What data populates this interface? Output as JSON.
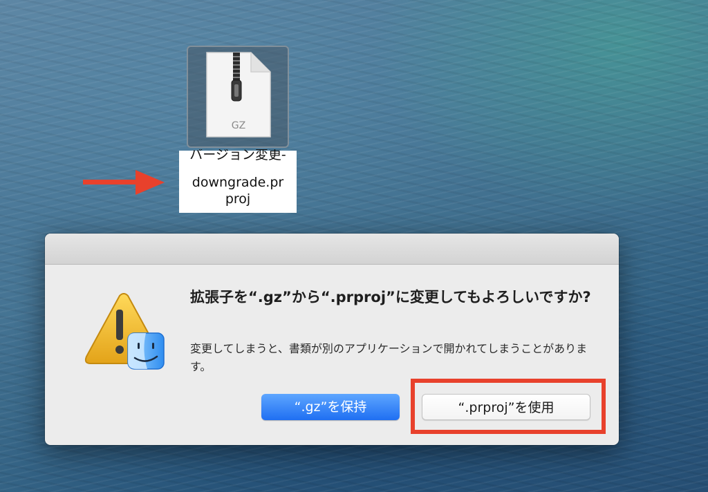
{
  "desktop": {
    "file": {
      "icon_type": "zip-archive-icon",
      "type_label": "GZ",
      "name_line1": "バージョン変更-",
      "name_line2": "downgrade.pr",
      "name_line3": "proj"
    },
    "annotation_color": "#e8412c"
  },
  "dialog": {
    "title": "拡張子を“.gz”から“.prproj”に変更してもよろしいですか?",
    "message": "変更してしまうと、書類が別のアプリケーションで開かれてしまうことがあります。",
    "buttons": {
      "keep_label": "“.gz”を保持",
      "use_label": "“.prproj”を使用"
    },
    "icon": "warning-finder-icon"
  }
}
